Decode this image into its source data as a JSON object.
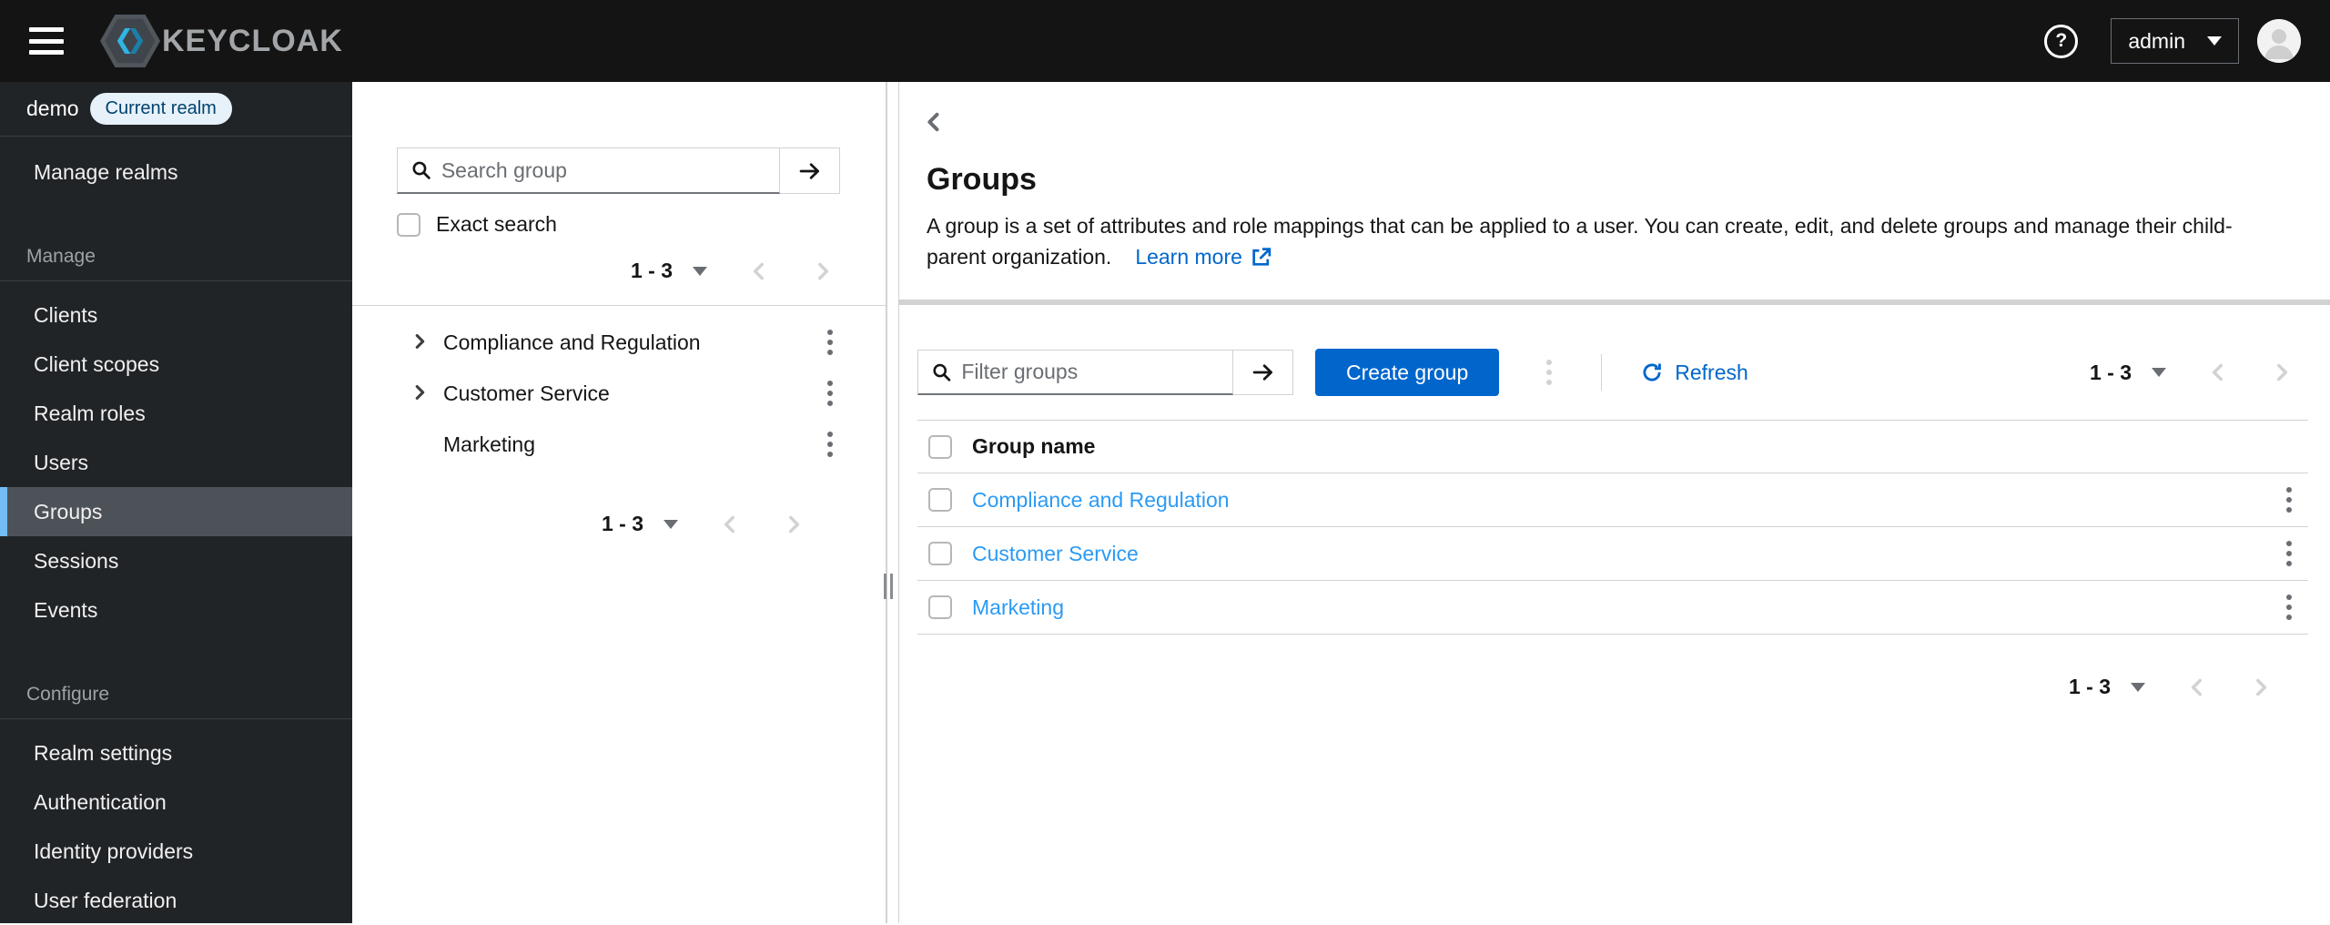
{
  "topbar": {
    "brand": "KEYCLOAK",
    "help_glyph": "?",
    "user_menu": "admin"
  },
  "sidebar": {
    "realm_name": "demo",
    "realm_badge": "Current realm",
    "manage_realms": "Manage realms",
    "manage_label": "Manage",
    "configure_label": "Configure",
    "manage_items": [
      {
        "label": "Clients"
      },
      {
        "label": "Client scopes"
      },
      {
        "label": "Realm roles"
      },
      {
        "label": "Users"
      },
      {
        "label": "Groups"
      },
      {
        "label": "Sessions"
      },
      {
        "label": "Events"
      }
    ],
    "configure_items": [
      {
        "label": "Realm settings"
      },
      {
        "label": "Authentication"
      },
      {
        "label": "Identity providers"
      },
      {
        "label": "User federation"
      }
    ]
  },
  "tree_panel": {
    "search_placeholder": "Search group",
    "exact_search_label": "Exact search",
    "pagination_range": "1 - 3",
    "items": [
      {
        "label": "Compliance and Regulation"
      },
      {
        "label": "Customer Service"
      },
      {
        "label": "Marketing"
      }
    ]
  },
  "main": {
    "title": "Groups",
    "description": "A group is a set of attributes and role mappings that can be applied to a user. You can create, edit, and delete groups and manage their child-parent organization.",
    "learn_more": "Learn more",
    "toolbar": {
      "filter_placeholder": "Filter groups",
      "create_button": "Create group",
      "refresh_label": "Refresh",
      "pagination_range": "1 - 3"
    },
    "table": {
      "header": "Group name",
      "rows": [
        {
          "name": "Compliance and Regulation"
        },
        {
          "name": "Customer Service"
        },
        {
          "name": "Marketing"
        }
      ]
    },
    "bottom_pagination_range": "1 - 3"
  },
  "colors": {
    "accent": "#0066cc",
    "row_link": "#2b9af3",
    "selected_nav_border": "#73bcf7",
    "badge_bg": "#e7f1fa",
    "topbar_bg": "#141414",
    "sidebar_bg": "#212427"
  }
}
